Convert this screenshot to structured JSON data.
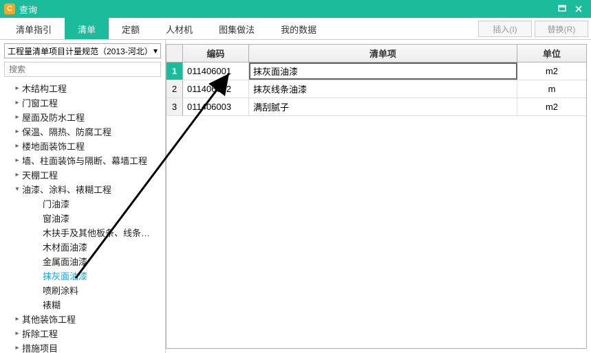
{
  "window": {
    "title": "查询",
    "logo_letter": "C"
  },
  "tabs": {
    "items": [
      "清单指引",
      "清单",
      "定额",
      "人材机",
      "图集做法",
      "我的数据"
    ],
    "active_index": 1
  },
  "actions": {
    "insert": "插入(I)",
    "replace": "替换(R)"
  },
  "selector": {
    "value": "工程量清单项目计量规范（2013-河北）"
  },
  "search": {
    "placeholder": "搜索"
  },
  "tree": [
    {
      "label": "木结构工程",
      "arrow": ">",
      "level": 1
    },
    {
      "label": "门窗工程",
      "arrow": ">",
      "level": 1
    },
    {
      "label": "屋面及防水工程",
      "arrow": ">",
      "level": 1
    },
    {
      "label": "保温、隔热、防腐工程",
      "arrow": ">",
      "level": 1
    },
    {
      "label": "楼地面装饰工程",
      "arrow": ">",
      "level": 1
    },
    {
      "label": "墙、柱面装饰与隔断、幕墙工程",
      "arrow": ">",
      "level": 1
    },
    {
      "label": "天棚工程",
      "arrow": ">",
      "level": 1
    },
    {
      "label": "油漆、涂料、裱糊工程",
      "arrow": "▾",
      "level": 1
    },
    {
      "label": "门油漆",
      "arrow": "",
      "level": 2
    },
    {
      "label": "窗油漆",
      "arrow": "",
      "level": 2
    },
    {
      "label": "木扶手及其他板条、线条…",
      "arrow": "",
      "level": 2
    },
    {
      "label": "木材面油漆",
      "arrow": "",
      "level": 2
    },
    {
      "label": "金属面油漆",
      "arrow": "",
      "level": 2
    },
    {
      "label": "抹灰面油漆",
      "arrow": "",
      "level": 2,
      "selected": true
    },
    {
      "label": "喷刷涂料",
      "arrow": "",
      "level": 2
    },
    {
      "label": "裱糊",
      "arrow": "",
      "level": 2
    },
    {
      "label": "其他装饰工程",
      "arrow": ">",
      "level": 1
    },
    {
      "label": "拆除工程",
      "arrow": ">",
      "level": 1
    },
    {
      "label": "措施项目",
      "arrow": ">",
      "level": 1
    }
  ],
  "grid": {
    "headers": {
      "num": "",
      "code": "编码",
      "item": "清单项",
      "unit": "单位"
    },
    "rows": [
      {
        "num": "1",
        "code": "011406001",
        "item": "抹灰面油漆",
        "unit": "m2",
        "selected": true
      },
      {
        "num": "2",
        "code": "011406002",
        "item": "抹灰线条油漆",
        "unit": "m"
      },
      {
        "num": "3",
        "code": "011406003",
        "item": "满刮腻子",
        "unit": "m2"
      }
    ]
  }
}
